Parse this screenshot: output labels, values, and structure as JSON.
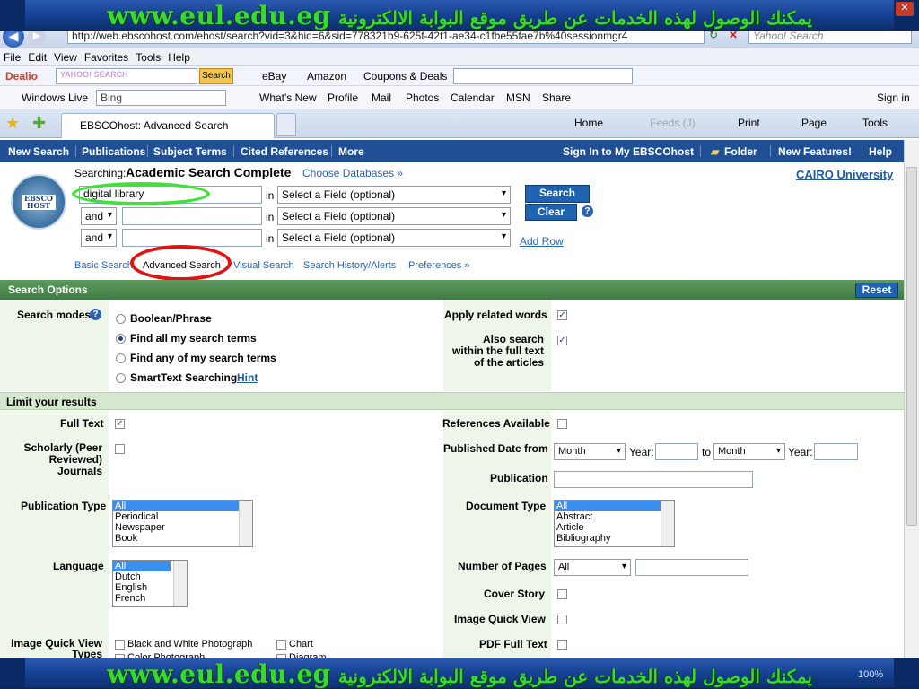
{
  "banner": {
    "url": "www.eul.edu.eg",
    "arabic": "يمكنك الوصول لهذه الخدمات عن طريق موقع البوابة الالكترونية"
  },
  "browser": {
    "address": "http://web.ebscohost.com/ehost/search?vid=3&hid=6&sid=778321b9-625f-42f1-ae34-c1fbe55fae7b%40sessionmgr4",
    "search_placeholder": "Yahoo! Search",
    "menu": [
      "File",
      "Edit",
      "View",
      "Favorites",
      "Tools",
      "Help"
    ],
    "toolbar1": {
      "dealio": "Dealio",
      "yahoo": "YAHOO! SEARCH",
      "search_btn": "Search",
      "ebay": "eBay",
      "amazon": "Amazon",
      "coupons": "Coupons & Deals"
    },
    "toolbar2": {
      "windows_live": "Windows Live",
      "bing": "Bing",
      "links": [
        "What's New",
        "Profile",
        "Mail",
        "Photos",
        "Calendar",
        "MSN",
        "Share"
      ],
      "sign_in": "Sign in"
    },
    "tab_title": "EBSCOhost: Advanced Search",
    "cmd": {
      "home": "Home",
      "feeds": "Feeds (J)",
      "print": "Print",
      "page": "Page",
      "tools": "Tools"
    },
    "status_zoom": "100%"
  },
  "ebsco_nav": {
    "left": [
      "New Search",
      "Publications",
      "Subject Terms",
      "Cited References",
      "More"
    ],
    "right": [
      "Sign In to My EBSCOhost",
      "Folder",
      "New Features!",
      "Help"
    ]
  },
  "search": {
    "logo_text": "EBSCO HOST",
    "searching_label": "Searching:",
    "database": "Academic Search Complete",
    "choose_db": "Choose Databases »",
    "institution": "CAIRO University",
    "row1_value": "digital library",
    "in_label": "in",
    "field_placeholder": "Select a Field (optional)",
    "bool_op": "and",
    "search_btn": "Search",
    "clear_btn": "Clear",
    "add_row": "Add Row",
    "subnav": [
      "Basic Search",
      "Advanced Search",
      "Visual Search",
      "Search History/Alerts",
      "Preferences »"
    ]
  },
  "options": {
    "title": "Search Options",
    "reset": "Reset",
    "search_modes": "Search modes",
    "modes": [
      "Boolean/Phrase",
      "Find all my search terms",
      "Find any of my search terms",
      "SmartText Searching"
    ],
    "hint": "Hint",
    "apply_related": "Apply related words",
    "also_search": "Also search within the full text of the articles"
  },
  "limits": {
    "title": "Limit your results",
    "full_text": "Full Text",
    "scholarly": "Scholarly (Peer Reviewed) Journals",
    "pub_type": "Publication Type",
    "pub_type_opts": [
      "All",
      "Periodical",
      "Newspaper",
      "Book"
    ],
    "language": "Language",
    "language_opts": [
      "All",
      "Dutch",
      "English",
      "French"
    ],
    "image_types": "Image Quick View Types",
    "image_opts": [
      "Black and White Photograph",
      "Chart",
      "Color Photograph",
      "Diagram"
    ],
    "refs": "References Available",
    "pub_date": "Published Date from",
    "month": "Month",
    "year": "Year:",
    "to": "to",
    "publication": "Publication",
    "doc_type": "Document Type",
    "doc_type_opts": [
      "All",
      "Abstract",
      "Article",
      "Bibliography"
    ],
    "num_pages": "Number of Pages",
    "num_pages_opt": "All",
    "cover_story": "Cover Story",
    "image_quick_view": "Image Quick View",
    "pdf_full_text": "PDF Full Text"
  }
}
